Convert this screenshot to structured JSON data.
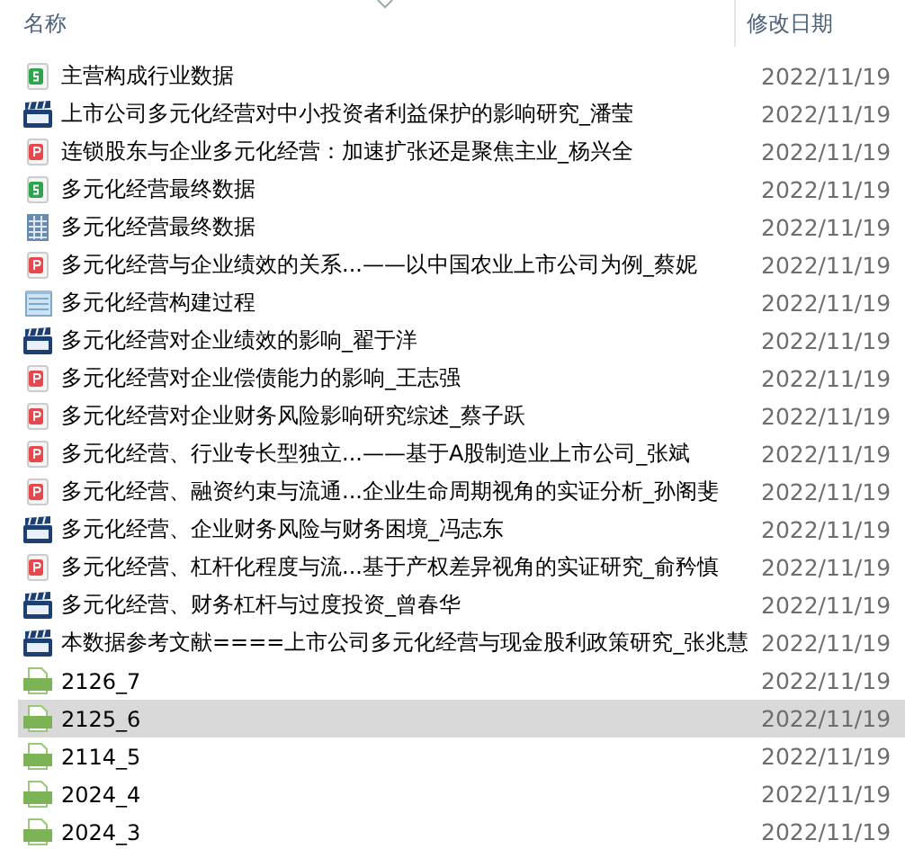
{
  "columns": [
    {
      "label": "名称"
    },
    {
      "label": "修改日期"
    }
  ],
  "files": [
    {
      "name": "主营构成行业数据",
      "kind": "sheet",
      "date": "2022/11/19",
      "selected": false
    },
    {
      "name": "上市公司多元化经营对中小投资者利益保护的影响研究_潘莹",
      "kind": "caj",
      "date": "2022/11/19",
      "selected": false
    },
    {
      "name": "连锁股东与企业多元化经营：加速扩张还是聚焦主业_杨兴全",
      "kind": "pdf",
      "date": "2022/11/19",
      "selected": false
    },
    {
      "name": "多元化经营最终数据",
      "kind": "sheet",
      "date": "2022/11/19",
      "selected": false
    },
    {
      "name": "多元化经营最终数据",
      "kind": "table",
      "date": "2022/11/19",
      "selected": false
    },
    {
      "name": "多元化经营与企业绩效的关系...——以中国农业上市公司为例_蔡妮",
      "kind": "pdf",
      "date": "2022/11/19",
      "selected": false
    },
    {
      "name": "多元化经营构建过程",
      "kind": "note",
      "date": "2022/11/19",
      "selected": false
    },
    {
      "name": "多元化经营对企业绩效的影响_翟于洋",
      "kind": "caj",
      "date": "2022/11/19",
      "selected": false
    },
    {
      "name": "多元化经营对企业偿债能力的影响_王志强",
      "kind": "pdf",
      "date": "2022/11/19",
      "selected": false
    },
    {
      "name": "多元化经营对企业财务风险影响研究综述_蔡子跃",
      "kind": "pdf",
      "date": "2022/11/19",
      "selected": false
    },
    {
      "name": "多元化经营、行业专长型独立...——基于A股制造业上市公司_张斌",
      "kind": "pdf",
      "date": "2022/11/19",
      "selected": false
    },
    {
      "name": "多元化经营、融资约束与流通...企业生命周期视角的实证分析_孙阁斐",
      "kind": "pdf",
      "date": "2022/11/19",
      "selected": false
    },
    {
      "name": "多元化经营、企业财务风险与财务困境_冯志东",
      "kind": "caj",
      "date": "2022/11/19",
      "selected": false
    },
    {
      "name": "多元化经营、杠杆化程度与流...基于产权差异视角的实证研究_俞矜慎",
      "kind": "pdf",
      "date": "2022/11/19",
      "selected": false
    },
    {
      "name": "多元化经营、财务杠杆与过度投资_曾春华",
      "kind": "caj",
      "date": "2022/11/19",
      "selected": false
    },
    {
      "name": "本数据参考文献====上市公司多元化经营与现金股利政策研究_张兆慧",
      "kind": "caj",
      "date": "2022/11/19",
      "selected": false
    },
    {
      "name": "2126_7",
      "kind": "png",
      "date": "2022/11/19",
      "selected": false
    },
    {
      "name": "2125_6",
      "kind": "png",
      "date": "2022/11/19",
      "selected": true
    },
    {
      "name": "2114_5",
      "kind": "png",
      "date": "2022/11/19",
      "selected": false
    },
    {
      "name": "2024_4",
      "kind": "png",
      "date": "2022/11/19",
      "selected": false
    },
    {
      "name": "2024_3",
      "kind": "png",
      "date": "2022/11/19",
      "selected": false
    }
  ]
}
